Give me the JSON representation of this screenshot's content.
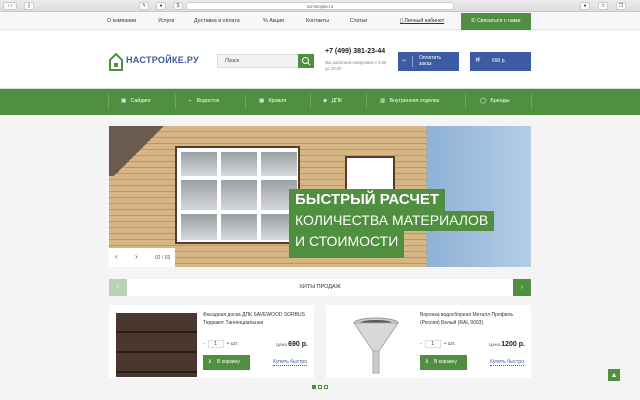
{
  "browser": {
    "url": "na-stroyke.ru"
  },
  "topnav": {
    "items": [
      "О компании",
      "Услуги",
      "Доставка и оплата",
      "Акции",
      "Контакты",
      "Статьи"
    ],
    "account": "Личный кабинет",
    "contact": "Связаться с нами"
  },
  "header": {
    "logo": "НАСТРОЙКЕ.РУ",
    "search_placeholder": "Поиск",
    "phone": "+7 (499) 381-23-44",
    "hours": "Мы работаем ежедневно с 9.00 до 20.00",
    "pay": "Оплатить заказ",
    "cart_total": "690 р."
  },
  "catnav": [
    "Сайдинг",
    "Водосток",
    "Кровля",
    "ДПК",
    "Внутренняя отделка",
    "Бренды"
  ],
  "banner": {
    "line1": "БЫСТРЫЙ РАСЧЕТ",
    "line2": "КОЛИЧЕСТВА МАТЕРИАЛОВ",
    "line3": "И СТОИМОСТИ",
    "counter": "02 / 03"
  },
  "hits": {
    "title": "ХИТЫ ПРОДАЖ"
  },
  "products": [
    {
      "title": "Фасадная доска ДПК SAVEWOOD SORBUS Терракот Тангенциальная",
      "qty": "1",
      "unit": "шт.",
      "price_label": "Цена",
      "price": "690 р.",
      "cart": "В корзину",
      "quick": "Купить быстро"
    },
    {
      "title": "Воронка водосборная Металл Профиль (Россия) Белый (RAL 9003)",
      "qty": "1",
      "unit": "шт.",
      "price_label": "Цена",
      "price": "1200 р.",
      "cart": "В корзину",
      "quick": "Купить быстро"
    }
  ],
  "colors": {
    "green": "#4f8f3f",
    "blue": "#3d5ba3"
  }
}
